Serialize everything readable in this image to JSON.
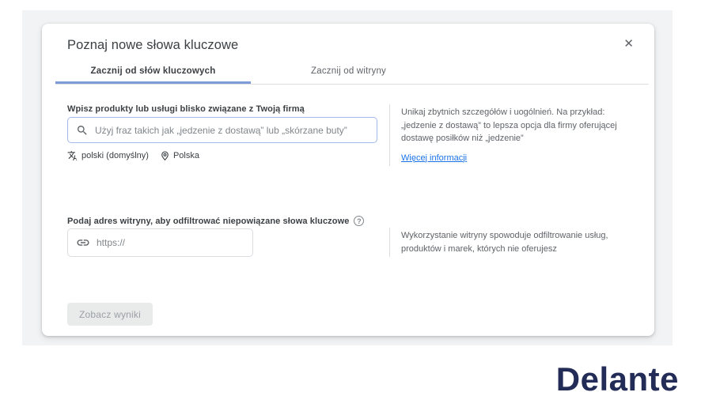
{
  "dialog": {
    "title": "Poznaj nowe słowa kluczowe",
    "close_glyph": "✕",
    "tabs": [
      {
        "label": "Zacznij od słów kluczowych",
        "active": true
      },
      {
        "label": "Zacznij od witryny",
        "active": false
      }
    ],
    "keyword_section": {
      "label": "Wpisz produkty lub usługi blisko związane z Twoją firmą",
      "input_value": "",
      "input_placeholder": "Użyj fraz takich jak „jedzenie z dostawą” lub „skórzane buty”",
      "language": "polski (domyślny)",
      "location": "Polska",
      "help_text": "Unikaj zbytnich szczegółów i uogólnień. Na przykład: „jedzenie z dostawą” to lepsza opcja dla firmy oferującej dostawę posiłków niż „jedzenie”",
      "help_link": "Więcej informacji"
    },
    "site_section": {
      "label": "Podaj adres witryny, aby odfiltrować niepowiązane słowa kluczowe",
      "help_glyph": "?",
      "input_value": "",
      "input_placeholder": "https://",
      "help_text": "Wykorzystanie witryny spowoduje odfiltrowanie usług, produktów i marek, których nie oferujesz"
    },
    "submit_button": {
      "label": "Zobacz wyniki",
      "enabled": false
    }
  },
  "branding": {
    "logo_text": "Delante"
  },
  "colors": {
    "backdrop": "#f1f3f4",
    "tab_underline": "#7d9ad9",
    "keyword_input_border": "#a3b9ec",
    "link": "#1a73e8",
    "logo": "#232c56",
    "disabled_button_bg": "#e9eaea",
    "disabled_button_text": "#9aa0a6"
  }
}
